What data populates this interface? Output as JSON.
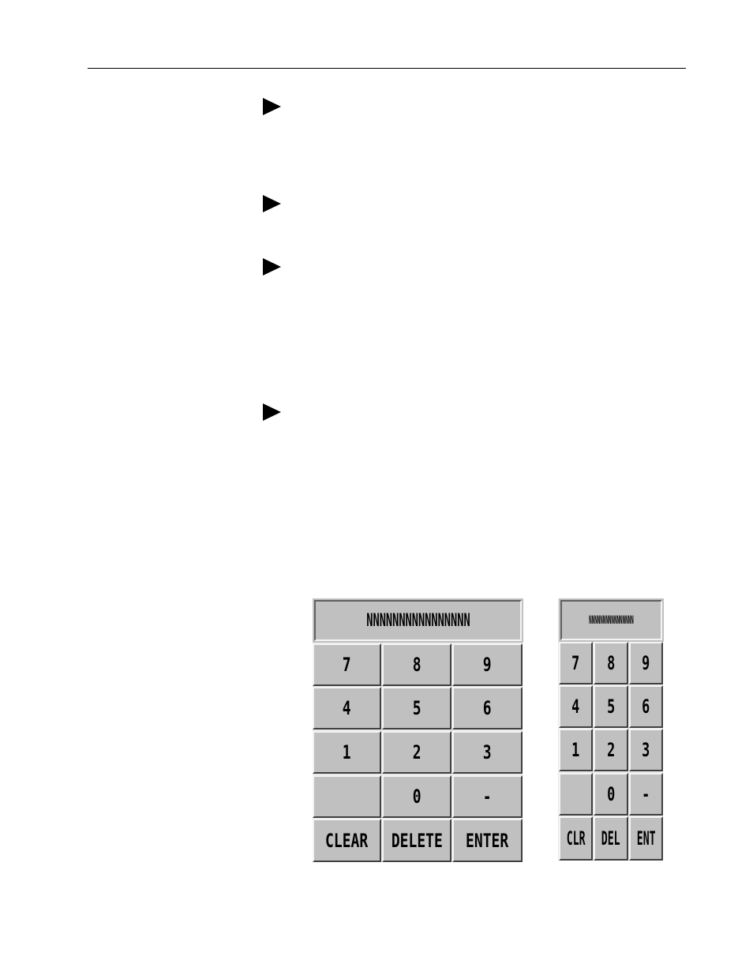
{
  "keypad_large": {
    "display": "NNNNNNNNNNNNNNNN",
    "rows": [
      [
        "7",
        "8",
        "9"
      ],
      [
        "4",
        "5",
        "6"
      ],
      [
        "1",
        "2",
        "3"
      ],
      [
        "",
        "0",
        "-"
      ],
      [
        "CLEAR",
        "DELETE",
        "ENTER"
      ]
    ]
  },
  "keypad_small": {
    "display": "NNNNNNNNNNNNNNNN",
    "rows": [
      [
        "7",
        "8",
        "9"
      ],
      [
        "4",
        "5",
        "6"
      ],
      [
        "1",
        "2",
        "3"
      ],
      [
        "",
        "0",
        "-"
      ],
      [
        "CLR",
        "DEL",
        "ENT"
      ]
    ]
  },
  "colors": {
    "key_face": "#c0c0c0",
    "highlight": "#f4f4f4",
    "shadow": "#404040"
  },
  "icons": {
    "bullet": "right-triangle-bullet"
  }
}
